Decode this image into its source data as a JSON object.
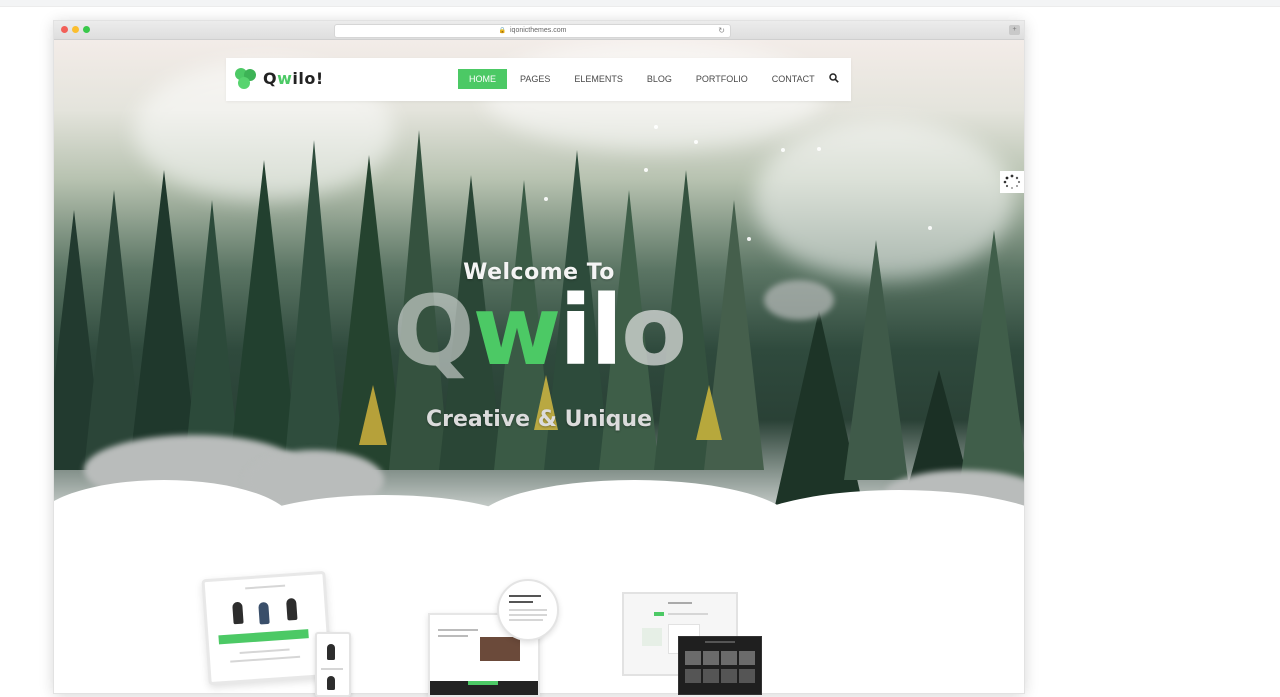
{
  "browser": {
    "url": "iqonicthemes.com",
    "window_controls": [
      "red",
      "yellow",
      "green"
    ]
  },
  "site": {
    "logo_text_before": "Q",
    "logo_text_accent": "w",
    "logo_text_after": "ilo!",
    "menu": [
      {
        "label": "HOME",
        "active": true
      },
      {
        "label": "PAGES",
        "active": false
      },
      {
        "label": "ELEMENTS",
        "active": false
      },
      {
        "label": "BLOG",
        "active": false
      },
      {
        "label": "PORTFOLIO",
        "active": false
      },
      {
        "label": "CONTACT",
        "active": false
      }
    ],
    "search_icon": "search-icon"
  },
  "hero": {
    "welcome": "Welcome To",
    "title_q": "Q",
    "title_w": "w",
    "title_rest": "il",
    "title_o": "o",
    "tagline": "Creative & Unique"
  },
  "colors": {
    "accent": "#4cc965",
    "text_dark": "#222222"
  }
}
